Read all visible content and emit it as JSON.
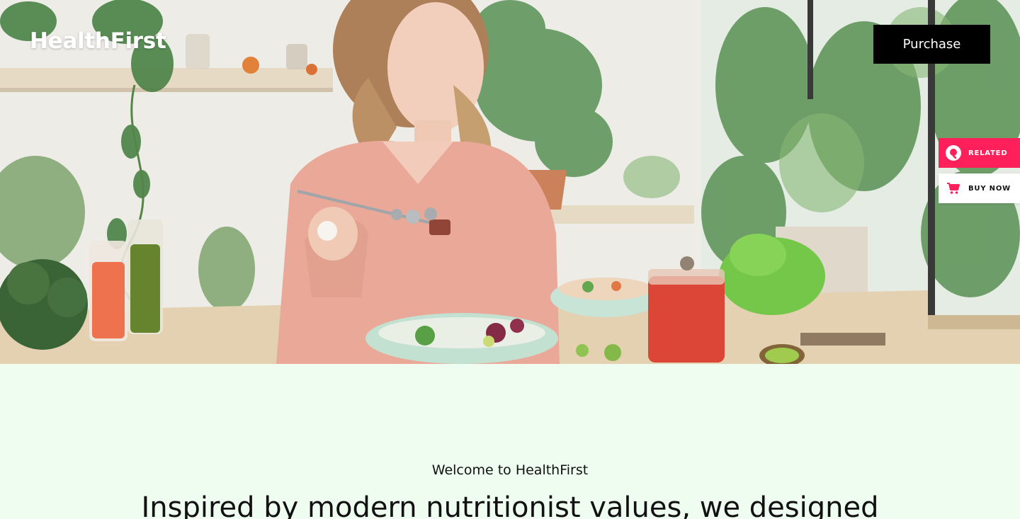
{
  "header": {
    "brand": "HealthFirst",
    "purchase_label": "Purchase"
  },
  "side_tabs": [
    {
      "label": "RELATED",
      "icon": "related-icon",
      "color": "#ff1f5a"
    },
    {
      "label": "BUY NOW",
      "icon": "cart-icon",
      "color": "#ff1f5a"
    }
  ],
  "hero": {
    "image": "woman-eating-salad-photo"
  },
  "content": {
    "eyebrow": "Welcome to HealthFirst",
    "headline": "Inspired by modern nutritionist values, we designed"
  },
  "colors": {
    "background": "#effcf0",
    "accent": "#ff1f5a",
    "button": "#000000"
  }
}
